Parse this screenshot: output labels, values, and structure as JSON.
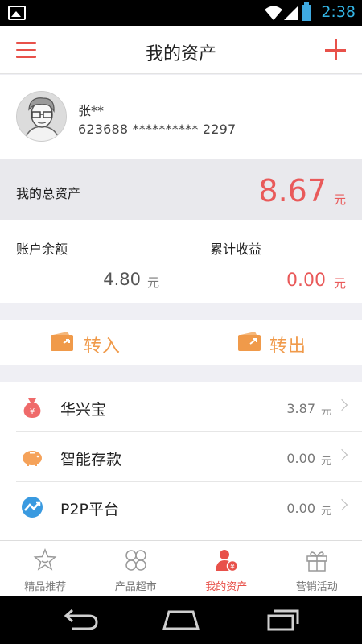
{
  "status_bar": {
    "time": "2:38"
  },
  "header": {
    "title": "我的资产"
  },
  "profile": {
    "name": "张**",
    "card": "623688 ********** 2297"
  },
  "total_assets": {
    "label": "我的总资产",
    "amount": "8.67",
    "unit": "元"
  },
  "balances": {
    "account_label": "账户余额",
    "account_value": "4.80",
    "account_unit": "元",
    "earnings_label": "累计收益",
    "earnings_value": "0.00",
    "earnings_unit": "元"
  },
  "transfer": {
    "in_label": "转入",
    "out_label": "转出"
  },
  "products": [
    {
      "name": "华兴宝",
      "value": "3.87",
      "unit": "元",
      "icon": "money-bag-icon"
    },
    {
      "name": "智能存款",
      "value": "0.00",
      "unit": "元",
      "icon": "piggy-bank-icon"
    },
    {
      "name": "P2P平台",
      "value": "0.00",
      "unit": "元",
      "icon": "p2p-icon"
    }
  ],
  "tabs": [
    {
      "label": "精品推荐",
      "icon": "star-icon"
    },
    {
      "label": "产品超市",
      "icon": "grid-icon"
    },
    {
      "label": "我的资产",
      "icon": "user-assets-icon",
      "active": true
    },
    {
      "label": "营销活动",
      "icon": "gift-icon"
    }
  ],
  "colors": {
    "accent": "#e8514a",
    "orange": "#f09a4a",
    "amount_red": "#e95a5a"
  }
}
